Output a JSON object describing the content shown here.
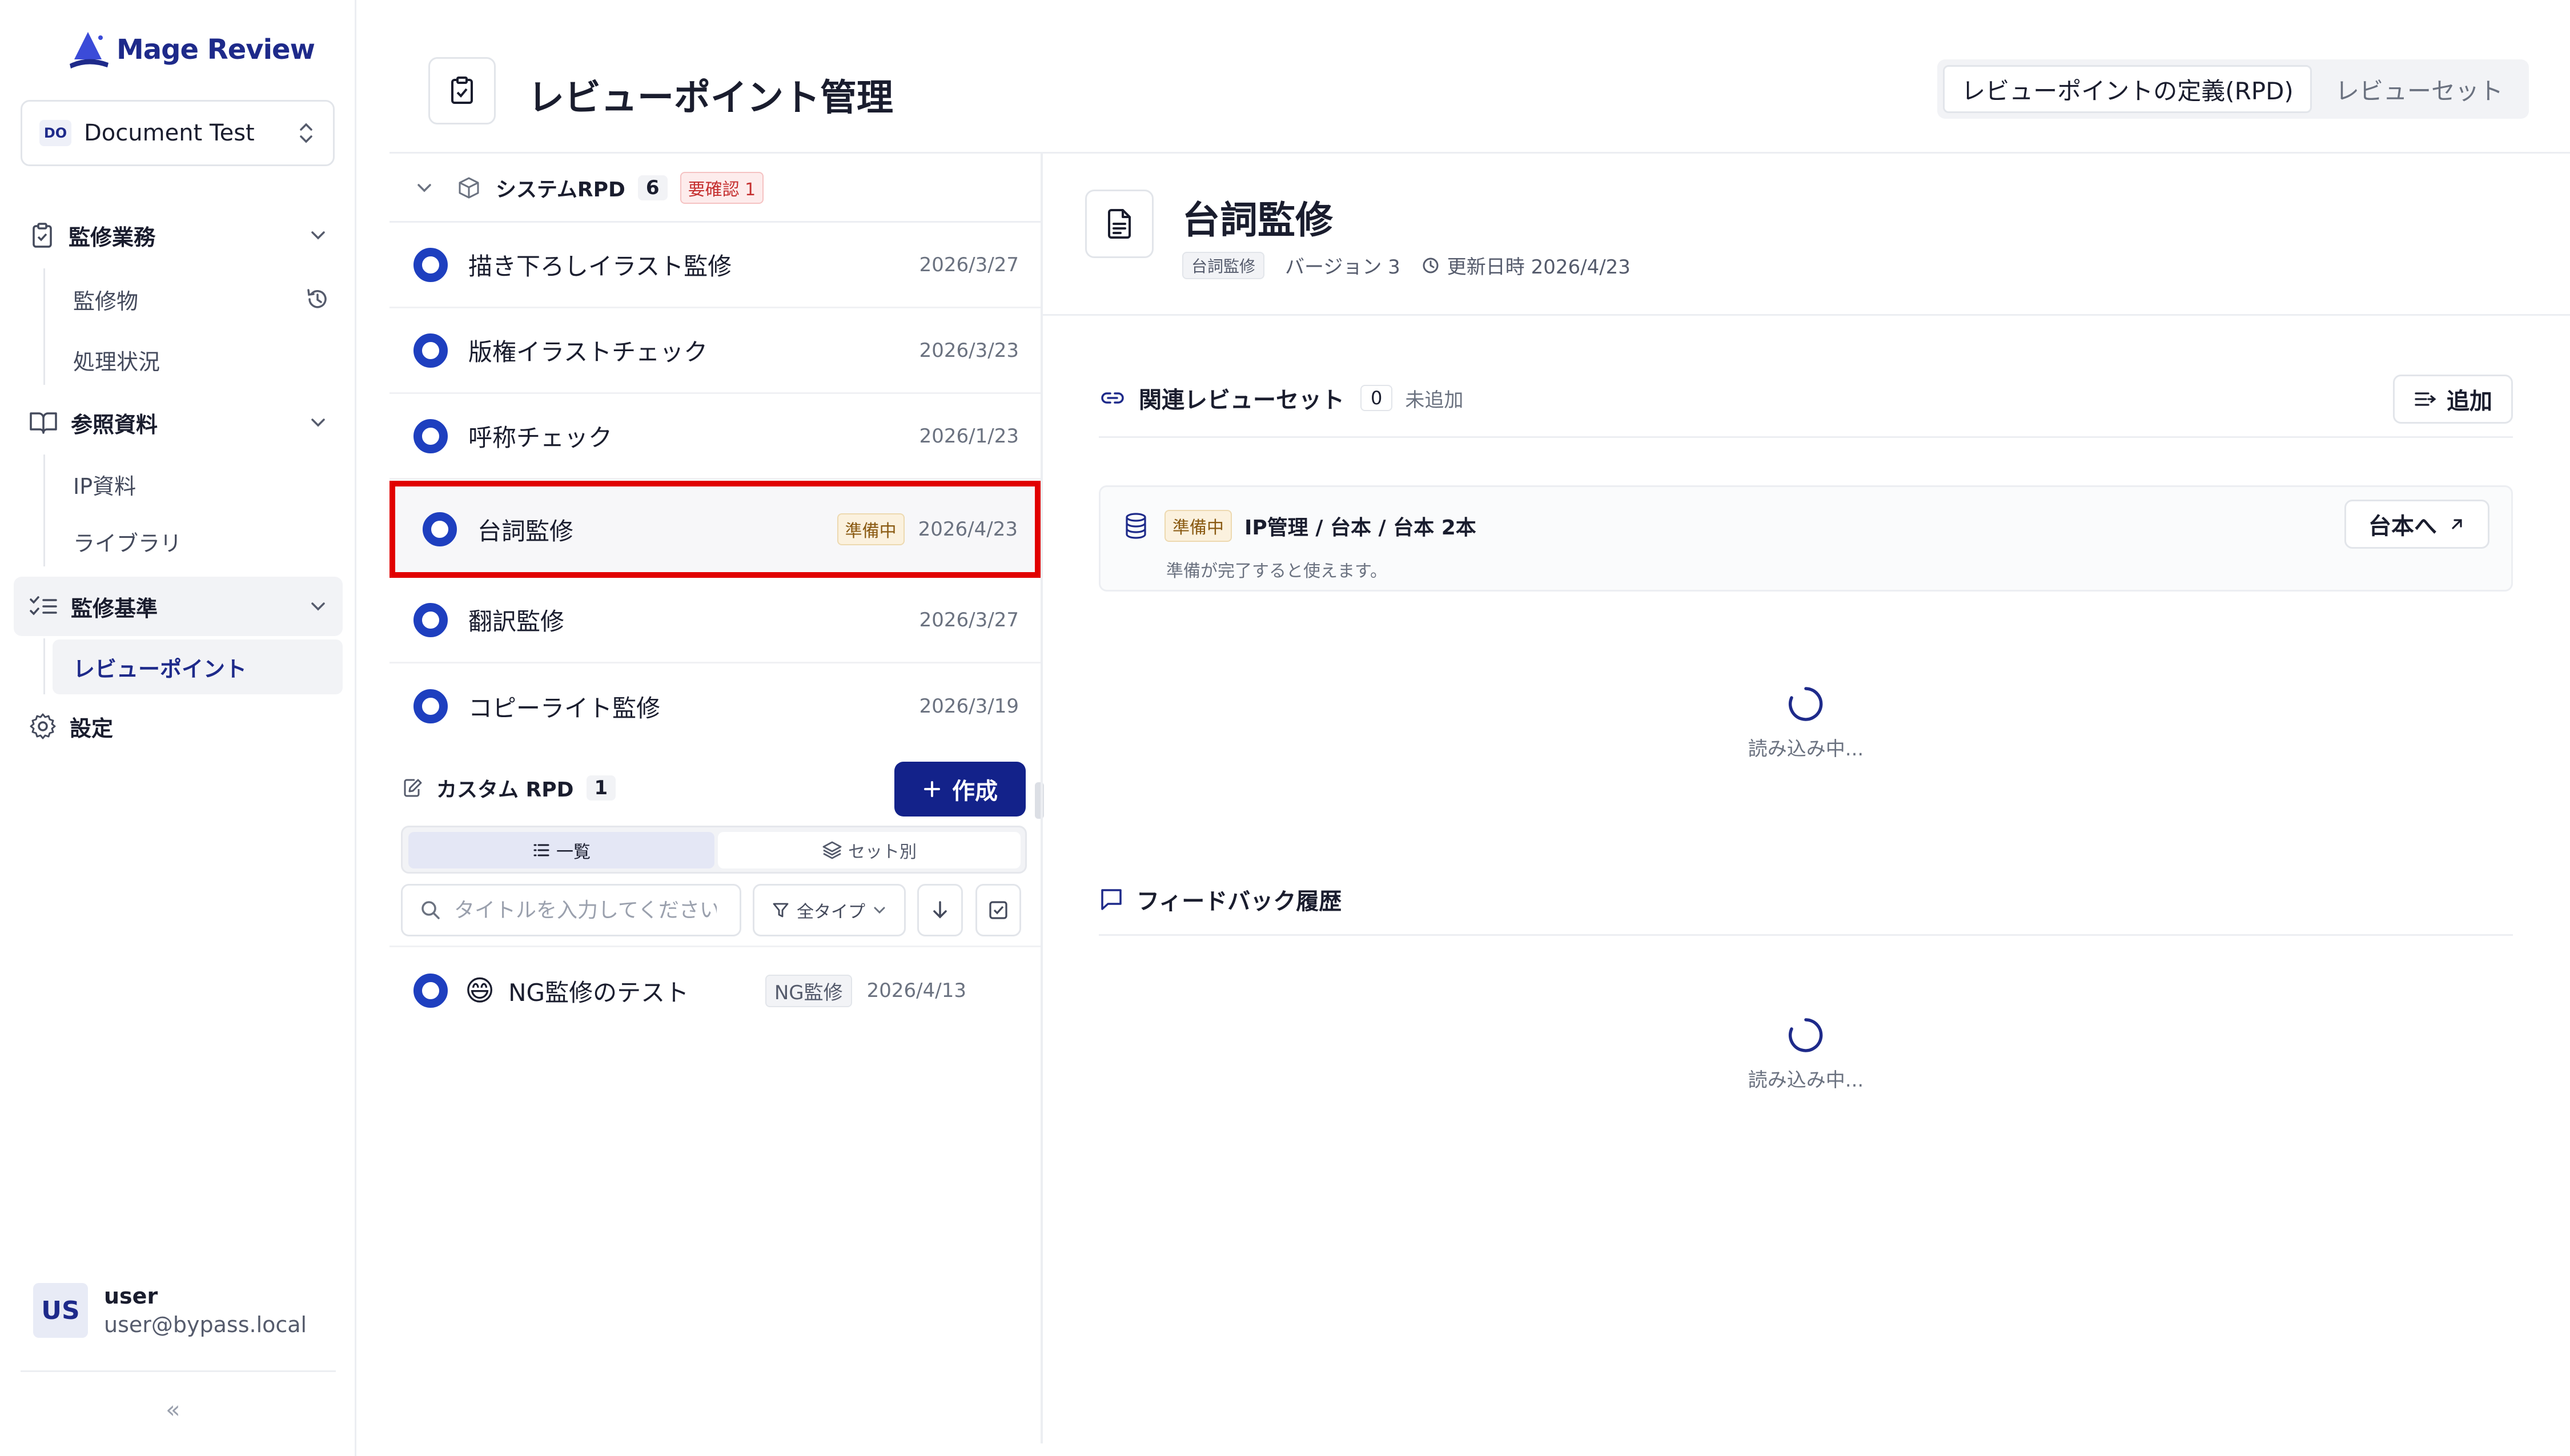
{
  "app": {
    "name": "Mage Review"
  },
  "workspace": {
    "badge": "DO",
    "name": "Document Test"
  },
  "nav": {
    "sections": [
      {
        "label": "監修業務",
        "items": [
          "監修物",
          "処理状況"
        ]
      },
      {
        "label": "参照資料",
        "items": [
          "IP資料",
          "ライブラリ"
        ]
      },
      {
        "label": "監修基準",
        "items": [
          "レビューポイント"
        ]
      },
      {
        "label": "設定"
      }
    ]
  },
  "user": {
    "initials": "US",
    "name": "user",
    "email": "user@bypass.local"
  },
  "collapse_glyph": "«",
  "header": {
    "title": "レビューポイント管理",
    "tabs": [
      {
        "label": "レビューポイントの定義(RPD)",
        "active": true
      },
      {
        "label": "レビューセット",
        "active": false
      }
    ]
  },
  "system_group": {
    "label": "システムRPD",
    "count": "6",
    "warn": "要確認 1"
  },
  "system_items": [
    {
      "title": "描き下ろしイラスト監修",
      "date": "2026/3/27"
    },
    {
      "title": "版権イラストチェック",
      "date": "2026/3/23"
    },
    {
      "title": "呼称チェック",
      "date": "2026/1/23"
    },
    {
      "title": "台詞監修",
      "date": "2026/4/23",
      "status": "準備中",
      "selected": true
    },
    {
      "title": "翻訳監修",
      "date": "2026/3/27"
    },
    {
      "title": "コピーライト監修",
      "date": "2026/3/19"
    }
  ],
  "custom_group": {
    "label": "カスタム RPD",
    "count": "1",
    "create_label": "作成"
  },
  "view_toggle": {
    "list": "一覧",
    "by_set": "セット別"
  },
  "search": {
    "placeholder": "タイトルを入力してください",
    "value": ""
  },
  "filter": {
    "label": "全タイプ"
  },
  "custom_items": [
    {
      "emoji": "😄",
      "title": "NG監修のテスト",
      "tag": "NG監修",
      "date": "2026/4/13"
    }
  ],
  "detail": {
    "title": "台詞監修",
    "tag": "台詞監修",
    "version": "バージョン 3",
    "updated": "更新日時 2026/4/23",
    "related": {
      "label": "関連レビューセット",
      "count": "0",
      "none": "未追加",
      "add_label": "追加",
      "card": {
        "status": "準備中",
        "title": "IP管理 / 台本 / 台本 2本",
        "note": "準備が完了すると使えます。",
        "button": "台本へ"
      },
      "loading": "読み込み中..."
    },
    "feedback": {
      "label": "フィードバック履歴",
      "loading": "読み込み中..."
    }
  },
  "colors": {
    "accent": "#13228a",
    "radio": "#1e3fbf",
    "selection_border": "#e10000",
    "warn": "#c53030"
  }
}
